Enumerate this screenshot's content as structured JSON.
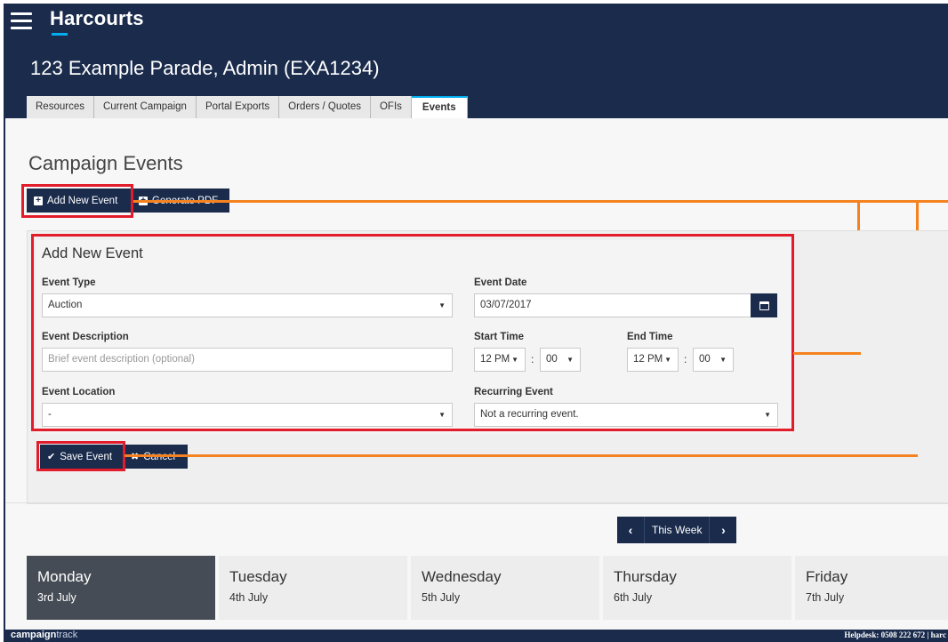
{
  "header": {
    "brand": "Harcourts",
    "page_heading": "123 Example Parade, Admin (EXA1234)",
    "tabs": [
      {
        "label": "Resources"
      },
      {
        "label": "Current Campaign"
      },
      {
        "label": "Portal Exports"
      },
      {
        "label": "Orders / Quotes"
      },
      {
        "label": "OFIs"
      },
      {
        "label": "Events",
        "active": true
      }
    ]
  },
  "content": {
    "title": "Campaign Events",
    "add_button": "Add New Event",
    "pdf_button": "Generate PDF"
  },
  "form": {
    "title": "Add New Event",
    "event_type": {
      "label": "Event Type",
      "value": "Auction"
    },
    "event_date": {
      "label": "Event Date",
      "value": "03/07/2017"
    },
    "event_description": {
      "label": "Event Description",
      "placeholder": "Brief event description (optional)"
    },
    "start_time": {
      "label": "Start Time",
      "hour": "12 PM",
      "minute": "00"
    },
    "end_time": {
      "label": "End Time",
      "hour": "12 PM",
      "minute": "00"
    },
    "event_location": {
      "label": "Event Location",
      "value": "-"
    },
    "recurring_event": {
      "label": "Recurring Event",
      "value": "Not a recurring event."
    },
    "save_button": "Save Event",
    "cancel_button": "Cancel"
  },
  "calendar": {
    "this_week": "This Week",
    "days": [
      {
        "name": "Monday",
        "date": "3rd July",
        "active": true
      },
      {
        "name": "Tuesday",
        "date": "4th July"
      },
      {
        "name": "Wednesday",
        "date": "5th July"
      },
      {
        "name": "Thursday",
        "date": "6th July"
      },
      {
        "name": "Friday",
        "date": "7th July"
      }
    ]
  },
  "footer": {
    "logo_bold": "campaign",
    "logo_light": "track",
    "helpdesk": "Helpdesk: 0508 222 672 | harc"
  },
  "colors": {
    "navy": "#1a2b4c",
    "accent_blue": "#00adef",
    "highlight_red": "#e21c2a",
    "callout_orange": "#f58220"
  },
  "icons": [
    "hamburger-icon",
    "plus-square-icon",
    "pdf-icon",
    "calendar-icon",
    "check-icon",
    "close-icon",
    "chevron-left-icon",
    "chevron-right-icon",
    "caret-down-icon"
  ]
}
